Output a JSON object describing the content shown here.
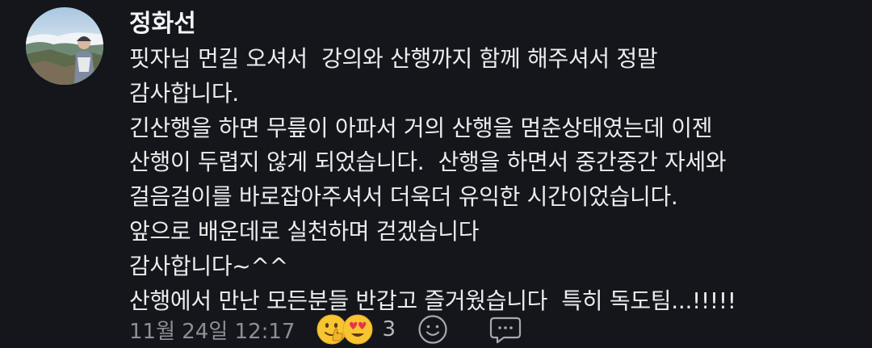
{
  "comment": {
    "author": "정화선",
    "lines": [
      "핏자님 먼길 오셔서  강의와 산행까지 함께 해주셔서 정말",
      "감사합니다.",
      "긴산행을 하면 무릎이 아파서 거의 산행을 멈춘상태였는데 이젠",
      "산행이 두렵지 않게 되었습니다.  산행을 하면서 중간중간 자세와",
      "걸음걸이를 바로잡아주셔서 더욱더 유익한 시간이었습니다.",
      "앞으로 배운데로 실천하며 걷겠습니다",
      "감사합니다~^^",
      "산행에서 만난 모든분들 반갑고 즐거웠습니다  특히 독도팀...!!!!!"
    ],
    "timestamp": "11월 24일 12:17",
    "reaction_count": "3",
    "reaction_icons": [
      "thumbs-up-emoji",
      "heart-eyes-emoji"
    ],
    "action_icons": [
      "smile-icon",
      "reply-icon"
    ]
  }
}
